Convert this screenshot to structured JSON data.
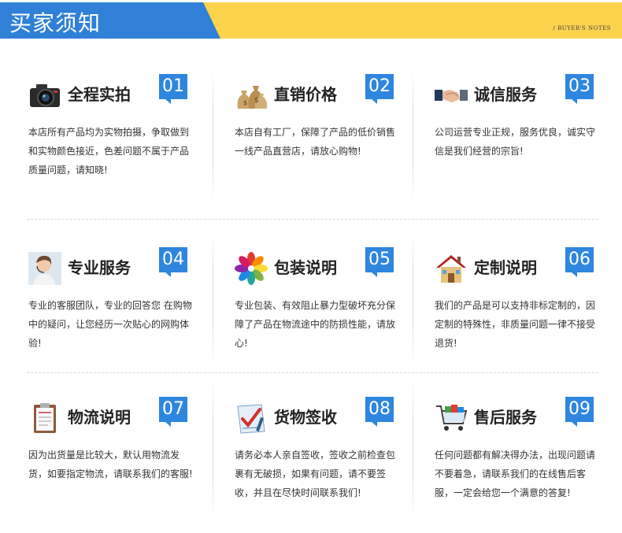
{
  "header": {
    "title": "买家须知",
    "subtitle": "/ BUYER'S NOTES"
  },
  "items": [
    {
      "title": "全程实拍",
      "number": "01",
      "icon": "camera-icon",
      "desc": "本店所有产品均为实物拍摄，争取做到和实物颜色接近，色差问题不属于产品质量问题，请知晓!"
    },
    {
      "title": "直销价格",
      "number": "02",
      "icon": "money-bags-icon",
      "desc": "本店自有工厂，保障了产品的低价销售一线产品直营店，请放心购物!"
    },
    {
      "title": "诚信服务",
      "number": "03",
      "icon": "handshake-icon",
      "desc": "公司运营专业正规，服务优良，诚实守信是我们经营的宗旨!"
    },
    {
      "title": "专业服务",
      "number": "04",
      "icon": "customer-service-icon",
      "desc": "专业的客服团队，专业的回答您 在购物中的疑问，让您经历一次贴心的网购体验!"
    },
    {
      "title": "包装说明",
      "number": "05",
      "icon": "color-wheel-icon",
      "desc": "专业包装、有效阻止暴力型破坏充分保障了产品在物流途中的防损性能，请放心!"
    },
    {
      "title": "定制说明",
      "number": "06",
      "icon": "house-icon",
      "desc": "我们的产品是可以支持非标定制的，因定制的特殊性，非质量问题一律不接受退货!"
    },
    {
      "title": "物流说明",
      "number": "07",
      "icon": "clipboard-icon",
      "desc": "因为出货量是比较大，默认用物流发货，如要指定物流，请联系我们的客服!"
    },
    {
      "title": "货物签收",
      "number": "08",
      "icon": "checklist-icon",
      "desc": "请务必本人亲自签收，签收之前检查包裹有无破损，如果有问题，请不要签收，并且在尽快时间联系我们!"
    },
    {
      "title": "售后服务",
      "number": "09",
      "icon": "shopping-cart-icon",
      "desc": "任何问题都有解决得办法，出现问题请不要着急，请联系我们的在线售后客服，一定会给您一个满意的答复!"
    }
  ],
  "colors": {
    "accent": "#2e86de",
    "header_blue": "#2f80d6",
    "header_yellow": "#fcd34d"
  }
}
